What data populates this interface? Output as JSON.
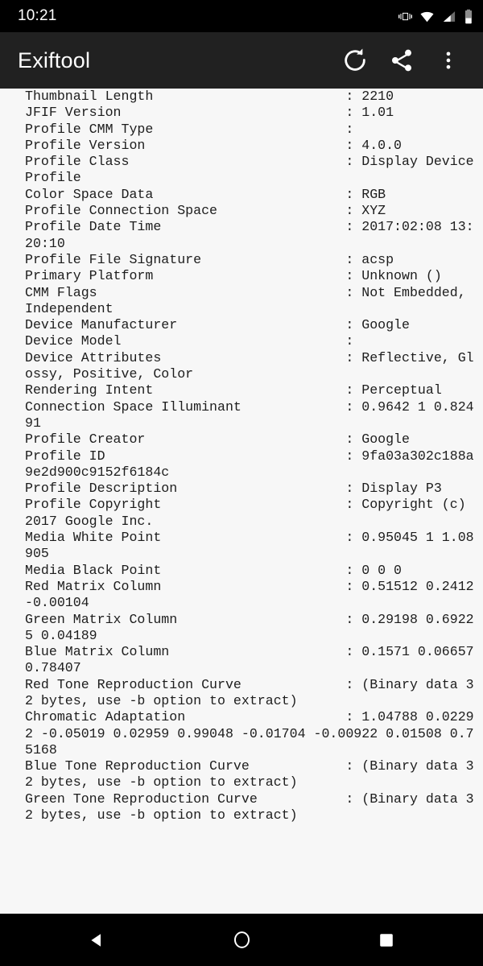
{
  "status_bar": {
    "time": "10:21",
    "icons": [
      "vibrate-icon",
      "wifi-icon",
      "cellular-signal-icon",
      "battery-icon"
    ]
  },
  "toolbar": {
    "title": "Exiftool",
    "actions": [
      {
        "name": "refresh-button",
        "icon": "refresh-icon",
        "label": "Refresh"
      },
      {
        "name": "share-button",
        "icon": "share-icon",
        "label": "Share"
      },
      {
        "name": "overflow-menu-button",
        "icon": "more-vertical-icon",
        "label": "More options"
      }
    ]
  },
  "colors": {
    "status_bar_bg": "#000000",
    "toolbar_bg": "#212121",
    "content_bg": "#f7f7f7",
    "text": "#1d1d1d",
    "icon": "#ffffff",
    "nav_bar_bg": "#000000"
  },
  "metadata": {
    "label_column_chars": 40,
    "separator": ":",
    "entries": [
      {
        "label": "Thumbnail Length",
        "value": "2210"
      },
      {
        "label": "JFIF Version",
        "value": "1.01"
      },
      {
        "label": "Profile CMM Type",
        "value": ""
      },
      {
        "label": "Profile Version",
        "value": "4.0.0"
      },
      {
        "label": "Profile Class",
        "value": "Display Device Profile"
      },
      {
        "label": "Color Space Data",
        "value": "RGB"
      },
      {
        "label": "Profile Connection Space",
        "value": "XYZ"
      },
      {
        "label": "Profile Date Time",
        "value": "2017:02:08 13:20:10"
      },
      {
        "label": "Profile File Signature",
        "value": "acsp"
      },
      {
        "label": "Primary Platform",
        "value": "Unknown ()"
      },
      {
        "label": "CMM Flags",
        "value": "Not Embedded, Independent"
      },
      {
        "label": "Device Manufacturer",
        "value": "Google"
      },
      {
        "label": "Device Model",
        "value": ""
      },
      {
        "label": "Device Attributes",
        "value": "Reflective, Glossy, Positive, Color"
      },
      {
        "label": "Rendering Intent",
        "value": "Perceptual"
      },
      {
        "label": "Connection Space Illuminant",
        "value": "0.9642 1 0.82491"
      },
      {
        "label": "Profile Creator",
        "value": "Google"
      },
      {
        "label": "Profile ID",
        "value": "9fa03a302c188a9e2d900c9152f6184c"
      },
      {
        "label": "Profile Description",
        "value": "Display P3"
      },
      {
        "label": "Profile Copyright",
        "value": "Copyright (c) 2017 Google Inc."
      },
      {
        "label": "Media White Point",
        "value": "0.95045 1 1.08905"
      },
      {
        "label": "Media Black Point",
        "value": "0 0 0"
      },
      {
        "label": "Red Matrix Column",
        "value": "0.51512 0.2412 -0.00104"
      },
      {
        "label": "Green Matrix Column",
        "value": "0.29198 0.69225 0.04189"
      },
      {
        "label": "Blue Matrix Column",
        "value": "0.1571 0.06657 0.78407"
      },
      {
        "label": "Red Tone Reproduction Curve",
        "value": "(Binary data 32 bytes, use -b option to extract)"
      },
      {
        "label": "Chromatic Adaptation",
        "value": "1.04788 0.02292 -0.05019 0.02959 0.99048 -0.01704 -0.00922 0.01508 0.75168"
      },
      {
        "label": "Blue Tone Reproduction Curve",
        "value": "(Binary data 32 bytes, use -b option to extract)"
      },
      {
        "label": "Green Tone Reproduction Curve",
        "value": "(Binary data 32 bytes, use -b option to extract)"
      }
    ]
  },
  "nav_bar": {
    "buttons": [
      {
        "name": "nav-back-button",
        "icon": "back-triangle-icon",
        "label": "Back"
      },
      {
        "name": "nav-home-button",
        "icon": "home-circle-icon",
        "label": "Home"
      },
      {
        "name": "nav-recents-button",
        "icon": "recents-square-icon",
        "label": "Recent apps"
      }
    ]
  }
}
